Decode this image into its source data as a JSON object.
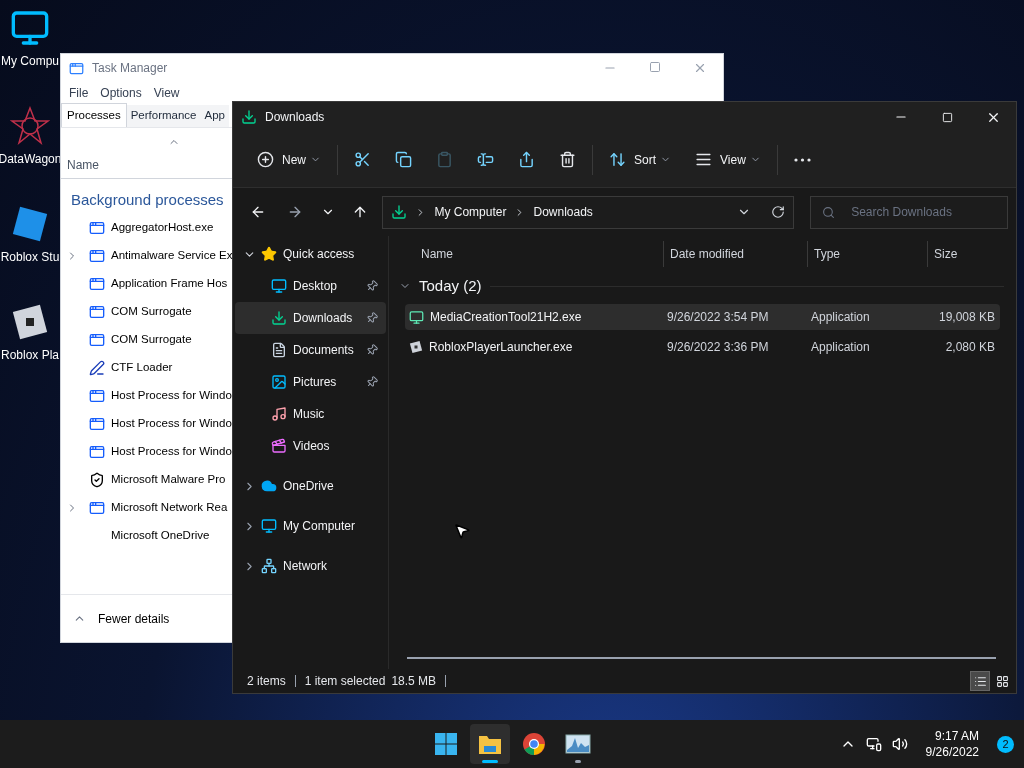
{
  "desktop_icons": [
    {
      "kind": "computer",
      "label": "My Compu"
    },
    {
      "kind": "star",
      "label": "DataWagon"
    },
    {
      "kind": "studio",
      "label": "Roblox Stu"
    },
    {
      "kind": "player",
      "label": "Roblox Pla"
    }
  ],
  "task_manager": {
    "title": "Task Manager",
    "menu": [
      "File",
      "Options",
      "View"
    ],
    "tabs": [
      {
        "label": "Processes",
        "selected": true
      },
      {
        "label": "Performance",
        "selected": false
      },
      {
        "label": "App",
        "selected": false
      }
    ],
    "name_column": "Name",
    "group": "Background processes",
    "processes": [
      {
        "name": "AggregatorHost.exe",
        "kind": "app",
        "expandable": false
      },
      {
        "name": "Antimalware Service Ex",
        "kind": "app",
        "expandable": true
      },
      {
        "name": "Application Frame Hos",
        "kind": "app",
        "expandable": false
      },
      {
        "name": "COM Surrogate",
        "kind": "app",
        "expandable": false
      },
      {
        "name": "COM Surrogate",
        "kind": "app",
        "expandable": false
      },
      {
        "name": "CTF Loader",
        "kind": "pen",
        "expandable": false
      },
      {
        "name": "Host Process for Windo",
        "kind": "app",
        "expandable": false
      },
      {
        "name": "Host Process for Windo",
        "kind": "app",
        "expandable": false
      },
      {
        "name": "Host Process for Windo",
        "kind": "app",
        "expandable": false
      },
      {
        "name": "Microsoft Malware Pro",
        "kind": "shield",
        "expandable": false
      },
      {
        "name": "Microsoft Network Rea",
        "kind": "app",
        "expandable": true
      },
      {
        "name": "Microsoft OneDrive",
        "kind": "none",
        "expandable": false
      }
    ],
    "footer": "Fewer details"
  },
  "explorer": {
    "title": "Downloads",
    "toolbar": [
      {
        "kind": "new",
        "label": "New",
        "disabled": false
      },
      {
        "kind": "cut",
        "disabled": false
      },
      {
        "kind": "copy",
        "disabled": false
      },
      {
        "kind": "paste",
        "disabled": true
      },
      {
        "kind": "rename",
        "disabled": false
      },
      {
        "kind": "share",
        "disabled": false
      },
      {
        "kind": "delete",
        "disabled": false
      },
      {
        "kind": "sort",
        "label": "Sort",
        "disabled": false
      },
      {
        "kind": "view",
        "label": "View",
        "disabled": false
      },
      {
        "kind": "more",
        "disabled": false
      }
    ],
    "breadcrumb": [
      "My Computer",
      "Downloads"
    ],
    "search": {
      "placeholder": "Search Downloads"
    },
    "nav": [
      {
        "kind": "star",
        "label": "Quick access",
        "expanded": true,
        "selected": false,
        "children": [
          {
            "kind": "desktop",
            "label": "Desktop",
            "pinned": true,
            "selected": false
          },
          {
            "kind": "downloads",
            "label": "Downloads",
            "pinned": true,
            "selected": true
          },
          {
            "kind": "documents",
            "label": "Documents",
            "pinned": true,
            "selected": false
          },
          {
            "kind": "pictures",
            "label": "Pictures",
            "pinned": true,
            "selected": false
          },
          {
            "kind": "music",
            "label": "Music",
            "pinned": false,
            "selected": false
          },
          {
            "kind": "videos",
            "label": "Videos",
            "pinned": false,
            "selected": false
          }
        ]
      },
      {
        "kind": "cloud",
        "label": "OneDrive",
        "expanded": false,
        "selected": false
      },
      {
        "kind": "computer",
        "label": "My Computer",
        "expanded": false,
        "selected": false
      },
      {
        "kind": "network",
        "label": "Network",
        "expanded": false,
        "selected": false
      }
    ],
    "columns": [
      "Name",
      "Date modified",
      "Type",
      "Size"
    ],
    "group": "Today (2)",
    "files": [
      {
        "kind": "setup",
        "name": "MediaCreationTool21H2.exe",
        "date": "9/26/2022 3:54 PM",
        "type": "Application",
        "size": "19,008 KB",
        "selected": true
      },
      {
        "kind": "roblox",
        "name": "RobloxPlayerLauncher.exe",
        "date": "9/26/2022 3:36 PM",
        "type": "Application",
        "size": "2,080 KB",
        "selected": false
      }
    ],
    "status": [
      "2 items",
      "1 item selected",
      "18.5 MB"
    ],
    "views": [
      {
        "kind": "details",
        "selected": true
      },
      {
        "kind": "tiles",
        "selected": false
      }
    ]
  },
  "taskbar": {
    "apps": [
      {
        "kind": "start",
        "active": false,
        "running": false
      },
      {
        "kind": "folder",
        "active": true,
        "running": true
      },
      {
        "kind": "chrome",
        "active": false,
        "running": false
      },
      {
        "kind": "monitor",
        "active": false,
        "running": true
      }
    ],
    "time": "9:17 AM",
    "date": "9/26/2022",
    "badge": "2"
  }
}
